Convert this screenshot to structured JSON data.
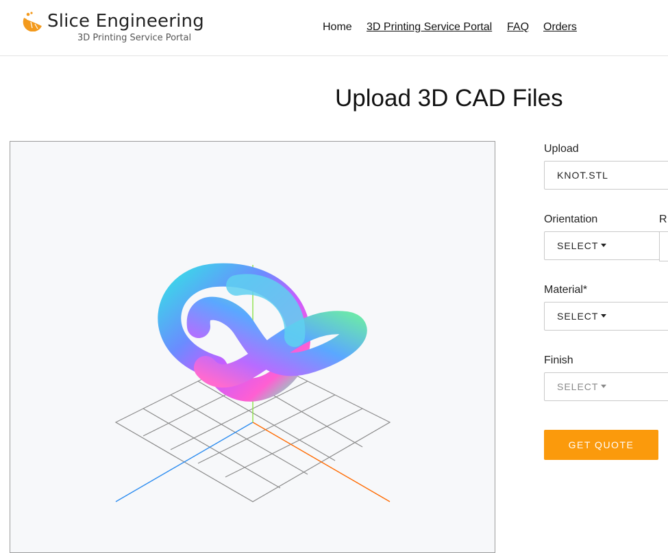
{
  "brand": {
    "name": "Slice Engineering",
    "subtitle": "3D Printing Service Portal",
    "accent": "#f39a1d"
  },
  "nav": {
    "items": [
      {
        "label": "Home"
      },
      {
        "label": "3D Printing Service Portal"
      },
      {
        "label": "FAQ"
      },
      {
        "label": "Orders"
      }
    ]
  },
  "page": {
    "title": "Upload 3D CAD Files"
  },
  "form": {
    "upload": {
      "label": "Upload",
      "value": "KNOT.STL"
    },
    "orientation": {
      "label": "Orientation",
      "value": "SELECT"
    },
    "second_label_partial": "R",
    "material": {
      "label": "Material*",
      "value": "SELECT"
    },
    "finish": {
      "label": "Finish",
      "value": "SELECT"
    },
    "quote_button": "GET QUOTE",
    "button_color": "#fb9a0c"
  },
  "viewer": {
    "model": "knot",
    "grid_color": "#8a8a8a",
    "axis_x_color": "#ff6a00",
    "axis_y_color": "#8ee04a",
    "axis_z_color": "#2c8cf0"
  }
}
